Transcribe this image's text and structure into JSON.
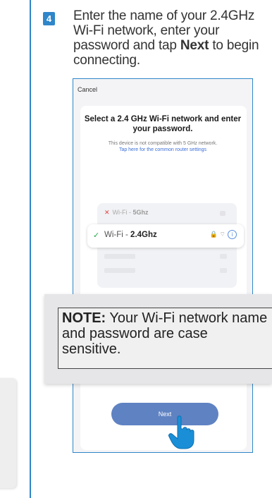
{
  "step": {
    "number": "4",
    "text_a": "Enter the name of your 2.4GHz Wi-Fi network, enter your password and tap ",
    "text_bold": "Next",
    "text_b": " to begin connecting."
  },
  "phone": {
    "cancel": "Cancel",
    "title": "Select a 2.4 GHz Wi-Fi network and enter your password.",
    "subtitle": "This device is not compatible with 5 GHz network.",
    "link": "Tap here for the common router settings",
    "networks": [
      {
        "prefix": "Wi-Fi - ",
        "band": "5Ghz",
        "status": "x",
        "selected": false
      },
      {
        "prefix": "Wi-Fi - ",
        "band": "2.4Ghz",
        "status": "check",
        "selected": true
      }
    ],
    "next_label": "Next"
  },
  "note": {
    "label": "NOTE:",
    "text": " Your Wi-Fi network name and password are case sensitive."
  },
  "colors": {
    "accent": "#2f86c9",
    "next_button": "#5f82c2",
    "link": "#3b6fd6",
    "error": "#e04040",
    "success": "#2aa84a"
  }
}
